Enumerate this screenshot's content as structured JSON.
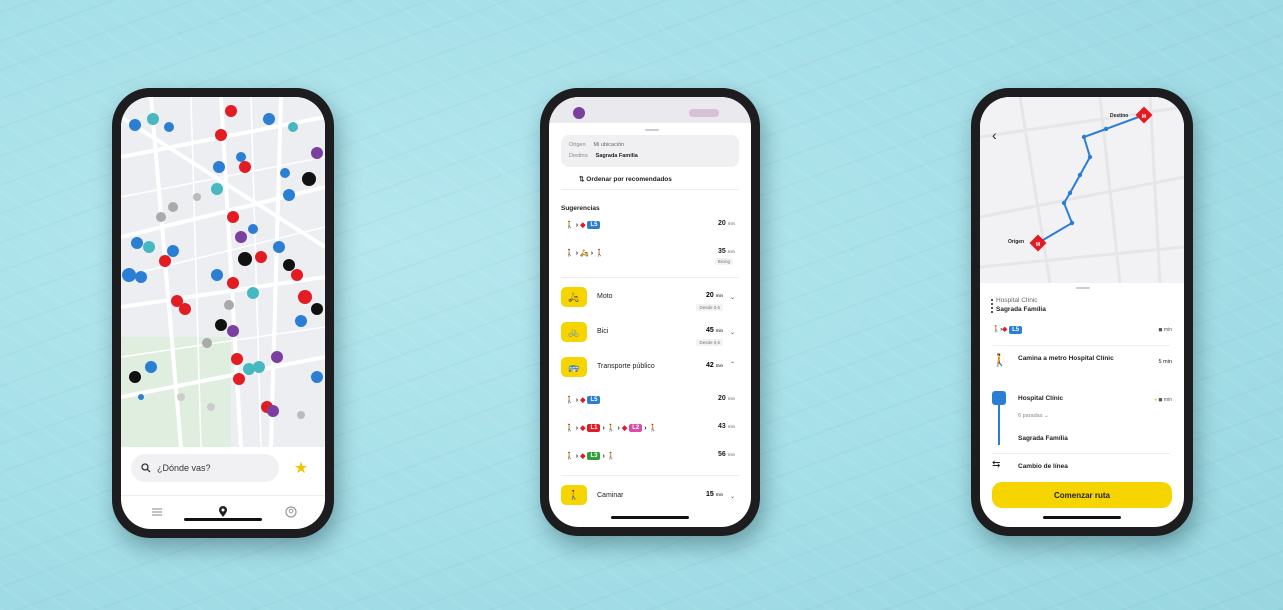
{
  "colors": {
    "accent": "#f5d400",
    "metro_red": "#e31b23",
    "bus_blue": "#2a7fd4"
  },
  "phone1": {
    "search_placeholder": "¿Dónde vas?",
    "icons": [
      "search-icon",
      "star-icon",
      "list-icon",
      "map-pin-icon",
      "profile-icon"
    ]
  },
  "phone2": {
    "origin_label": "Origen",
    "origin_value": "Mi ubicación",
    "destination_label": "Destino",
    "destination_value": "Sagrada Família",
    "sort_label": "Ordenar por recomendados",
    "suggestions_title": "Sugerencias",
    "suggestions": [
      {
        "line": "L5",
        "minutes": "20",
        "unit": "min"
      },
      {
        "minutes": "35",
        "unit": "min",
        "sub": "Bicing"
      }
    ],
    "modes": [
      {
        "name": "Moto",
        "minutes": "20",
        "unit": "min",
        "sub": "Desde 0,5"
      },
      {
        "name": "Bici",
        "minutes": "45",
        "unit": "min",
        "sub": "Desde 0,5"
      },
      {
        "name": "Transporte público",
        "minutes": "42",
        "unit": "min"
      }
    ],
    "transit_options": [
      {
        "lines": [
          "L5"
        ],
        "minutes": "20",
        "unit": "min"
      },
      {
        "lines": [
          "L1",
          "L2"
        ],
        "minutes": "43",
        "unit": "min"
      },
      {
        "lines": [
          "L3"
        ],
        "minutes": "56",
        "unit": "min"
      }
    ],
    "walk": {
      "name": "Caminar",
      "minutes": "15",
      "unit": "min"
    }
  },
  "phone3": {
    "origin_stop": "Origen",
    "destination_stop": "Destino",
    "from": "Hospital Clínic",
    "to": "Sagrada Família",
    "line": "L5",
    "walk_text": "Camina a metro Hospital Clínic",
    "walk_minutes": "5 min",
    "metro_stop": "Hospital Clínic",
    "metro_sub": "6 paradas",
    "metro_dest": "Sagrada Família",
    "change_line": "Cambio de línea",
    "start_button": "Comenzar ruta"
  }
}
